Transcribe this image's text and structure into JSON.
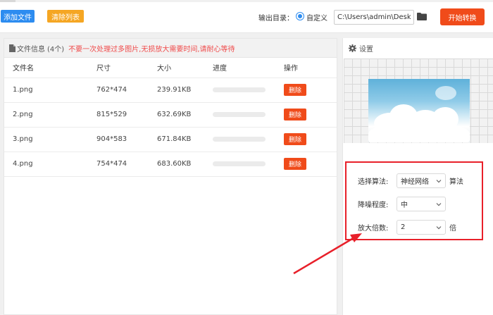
{
  "toolbar": {
    "add_label": "添加文件",
    "clear_label": "清除列表",
    "output_label": "输出目录：",
    "radio_label": "自定义",
    "path_value": "C:\\Users\\admin\\Deskto",
    "start_label": "开始转换"
  },
  "file_panel": {
    "title": "文件信息",
    "count": "(4个)",
    "warning": "不要一次处理过多图片,无损放大需要时间,请耐心等待",
    "columns": [
      "文件名",
      "尺寸",
      "大小",
      "进度",
      "操作"
    ],
    "rows": [
      {
        "name": "1.png",
        "size": "762*474",
        "filesize": "239.91KB",
        "progress": 0,
        "action": "删除"
      },
      {
        "name": "2.png",
        "size": "815*529",
        "filesize": "632.69KB",
        "progress": 0,
        "action": "删除"
      },
      {
        "name": "3.png",
        "size": "904*583",
        "filesize": "671.84KB",
        "progress": 0,
        "action": "删除"
      },
      {
        "name": "4.png",
        "size": "754*474",
        "filesize": "683.60KB",
        "progress": 0,
        "action": "删除"
      }
    ]
  },
  "settings": {
    "title": "设置",
    "algorithm_label": "选择算法:",
    "algorithm_value": "神经网络",
    "algorithm_suffix": "算法",
    "denoise_label": "降噪程度:",
    "denoise_value": "中",
    "scale_label": "放大倍数:",
    "scale_value": "2",
    "scale_suffix": "倍"
  },
  "colors": {
    "primary": "#2d8cf0",
    "warning": "#f5a623",
    "danger": "#f04b1a",
    "highlight": "#e8202a"
  },
  "icons": {
    "folder": "folder-icon",
    "doc": "doc-icon",
    "gear": "gear-icon",
    "chevron": "chevron-down-icon"
  }
}
